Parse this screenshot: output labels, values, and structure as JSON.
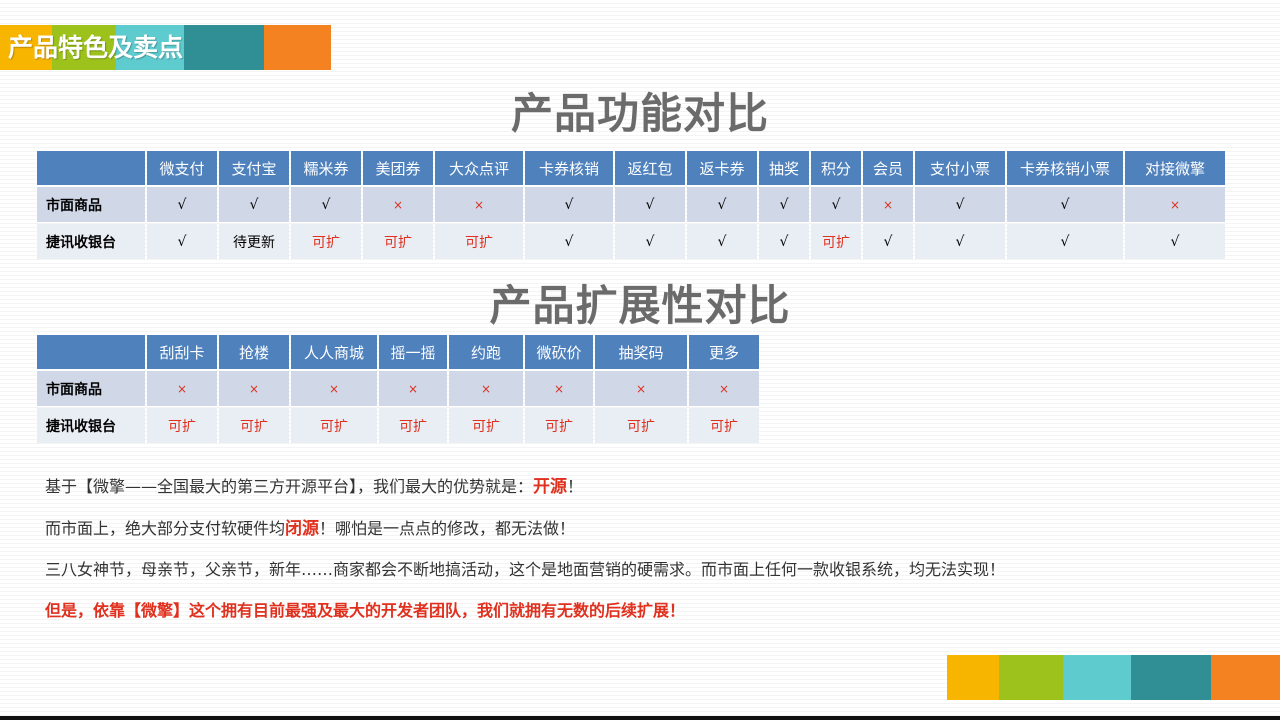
{
  "header": {
    "title": "产品特色及卖点",
    "colors": [
      "#f7b500",
      "#9dc21b",
      "#5ecbcf",
      "#2f8f94",
      "#f58220"
    ]
  },
  "section1": {
    "title": "产品功能对比",
    "columns": [
      "微支付",
      "支付宝",
      "糯米券",
      "美团券",
      "大众点评",
      "卡券核销",
      "返红包",
      "返卡券",
      "抽奖",
      "积分",
      "会员",
      "支付小票",
      "卡券核销小票",
      "对接微擎"
    ],
    "rows": [
      {
        "label": "市面商品",
        "cells": [
          "√",
          "√",
          "√",
          "×",
          "×",
          "√",
          "√",
          "√",
          "√",
          "√",
          "×",
          "√",
          "√",
          "×"
        ]
      },
      {
        "label": "捷讯收银台",
        "cells": [
          "√",
          "待更新",
          "可扩",
          "可扩",
          "可扩",
          "√",
          "√",
          "√",
          "√",
          "可扩",
          "√",
          "√",
          "√",
          "√"
        ]
      }
    ]
  },
  "section2": {
    "title": "产品扩展性对比",
    "columns": [
      "刮刮卡",
      "抢楼",
      "人人商城",
      "摇一摇",
      "约跑",
      "微砍价",
      "抽奖码",
      "更多"
    ],
    "rows": [
      {
        "label": "市面商品",
        "cells": [
          "×",
          "×",
          "×",
          "×",
          "×",
          "×",
          "×",
          "×"
        ]
      },
      {
        "label": "捷讯收银台",
        "cells": [
          "可扩",
          "可扩",
          "可扩",
          "可扩",
          "可扩",
          "可扩",
          "可扩",
          "可扩"
        ]
      }
    ]
  },
  "paragraphs": {
    "p1_a": "基于【微擎——全国最大的第三方开源平台】，我们最大的优势就是：",
    "p1_hl": "开源",
    "p1_b": "！",
    "p2_a": "而市面上，绝大部分支付软硬件均",
    "p2_hl": "闭源",
    "p2_b": "！哪怕是一点点的修改，都无法做！",
    "p3": "三八女神节，母亲节，父亲节，新年……商家都会不断地搞活动，这个是地面营销的硬需求。而市面上任何一款收银系统，均无法实现！",
    "p4": "但是，依靠【微擎】这个拥有目前最强及最大的开发者团队，我们就拥有无数的后续扩展！"
  },
  "footer": {
    "colors": [
      "#f7b500",
      "#9dc21b",
      "#5ecbcf",
      "#2f8f94",
      "#f58220"
    ]
  },
  "theme": {
    "table_header": "#4f81bd",
    "row_odd": "#d0d8e8",
    "row_even": "#e9edf4",
    "accent_red": "#e0301e",
    "title_gray": "#6b6b6b"
  }
}
